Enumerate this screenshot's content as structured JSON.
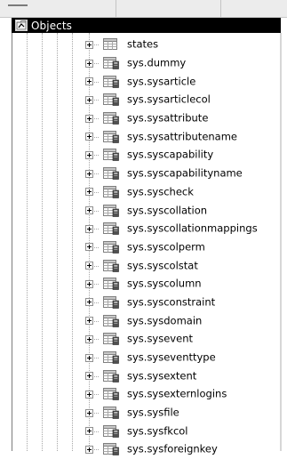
{
  "panel": {
    "title": "Objects",
    "title_icon": "objects-folder-icon"
  },
  "tree": {
    "items": [
      {
        "label": "states",
        "icon": "table-icon"
      },
      {
        "label": "sys.dummy",
        "icon": "system-table-icon"
      },
      {
        "label": "sys.sysarticle",
        "icon": "system-table-icon"
      },
      {
        "label": "sys.sysarticlecol",
        "icon": "system-table-icon"
      },
      {
        "label": "sys.sysattribute",
        "icon": "system-table-icon"
      },
      {
        "label": "sys.sysattributename",
        "icon": "system-table-icon"
      },
      {
        "label": "sys.syscapability",
        "icon": "system-table-icon"
      },
      {
        "label": "sys.syscapabilityname",
        "icon": "system-table-icon"
      },
      {
        "label": "sys.syscheck",
        "icon": "system-table-icon"
      },
      {
        "label": "sys.syscollation",
        "icon": "system-table-icon"
      },
      {
        "label": "sys.syscollationmappings",
        "icon": "system-table-icon"
      },
      {
        "label": "sys.syscolperm",
        "icon": "system-table-icon"
      },
      {
        "label": "sys.syscolstat",
        "icon": "system-table-icon"
      },
      {
        "label": "sys.syscolumn",
        "icon": "system-table-icon"
      },
      {
        "label": "sys.sysconstraint",
        "icon": "system-table-icon"
      },
      {
        "label": "sys.sysdomain",
        "icon": "system-table-icon"
      },
      {
        "label": "sys.sysevent",
        "icon": "system-table-icon"
      },
      {
        "label": "sys.syseventtype",
        "icon": "system-table-icon"
      },
      {
        "label": "sys.sysextent",
        "icon": "system-table-icon"
      },
      {
        "label": "sys.sysexternlogins",
        "icon": "system-table-icon"
      },
      {
        "label": "sys.sysfile",
        "icon": "system-table-icon"
      },
      {
        "label": "sys.sysfkcol",
        "icon": "system-table-icon"
      },
      {
        "label": "sys.sysforeignkey",
        "icon": "system-table-icon"
      }
    ]
  }
}
